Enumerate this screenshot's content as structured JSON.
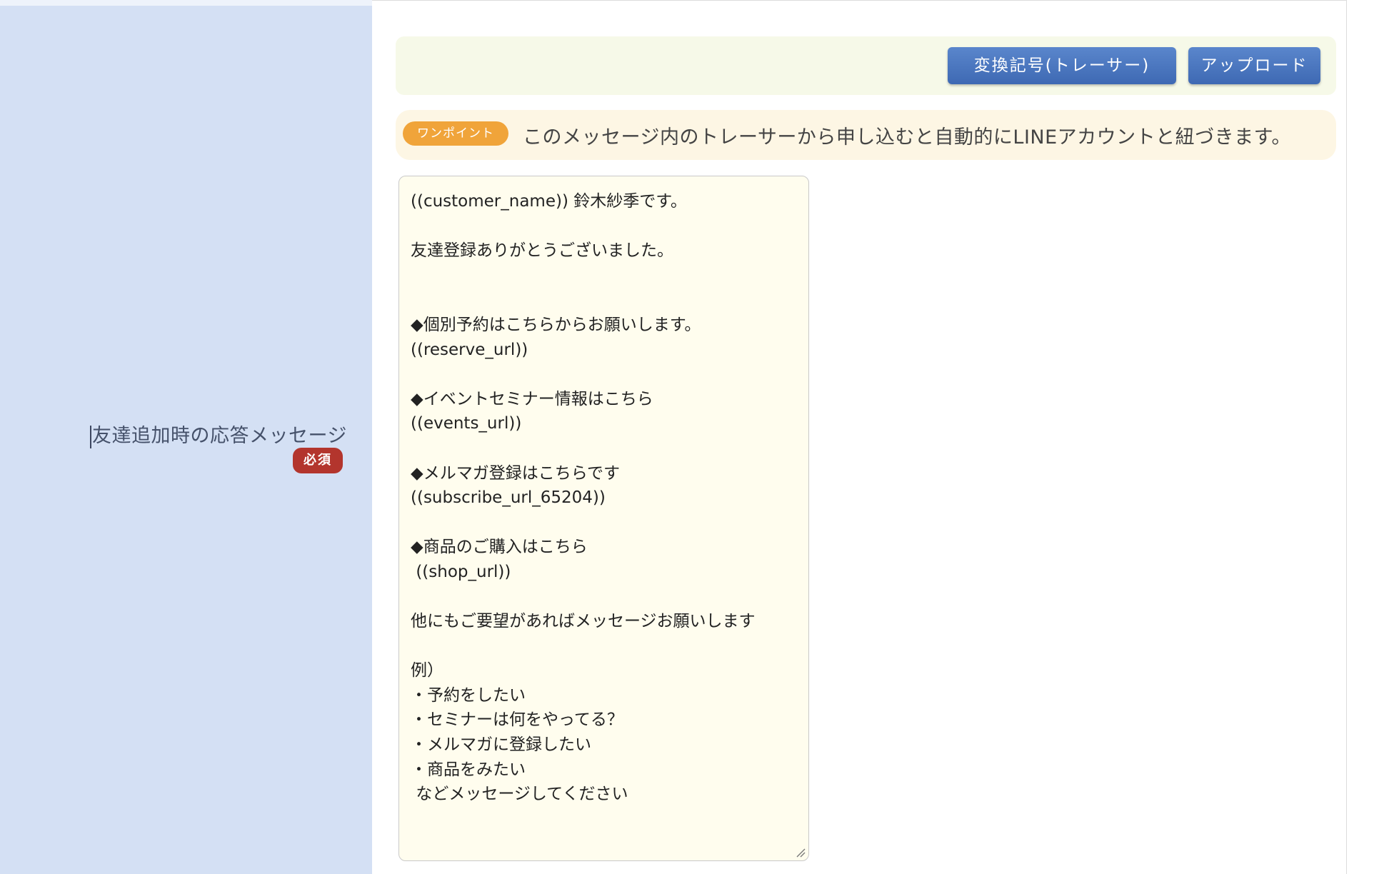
{
  "field": {
    "label": "友達追加時の応答メッセージ",
    "required_badge": "必須"
  },
  "toolbar": {
    "tracer_button": "変換記号(トレーサー)",
    "upload_button": "アップロード"
  },
  "tip": {
    "badge": "ワンポイント",
    "text": "このメッセージ内のトレーサーから申し込むと自動的にLINEアカウントと紐づきます。"
  },
  "message": {
    "value": "((customer_name)) 鈴木紗季です。\n\n友達登録ありがとうございました。\n\n\n◆個別予約はこちらからお願いします。\n((reserve_url))\n\n◆イベントセミナー情報はこちら\n((events_url))\n\n◆メルマガ登録はこちらです\n((subscribe_url_65204))\n\n◆商品のご購入はこちら\n ((shop_url))\n\n他にもご要望があればメッセージお願いします\n\n例）\n・予約をしたい\n・セミナーは何をやってる？\n・メルマガに登録したい\n・商品をみたい\n などメッセージしてください"
  },
  "colors": {
    "label_column_bg": "#d4e0f4",
    "required_badge": "#b3352d",
    "button_blue": "#3e69b3",
    "tip_badge": "#f0a43a",
    "tip_bg": "#fdf6e4",
    "toolbar_bg": "#f6f9e8",
    "textarea_bg": "#fffdee"
  },
  "icons": {
    "resize_handle": "resize-grip-icon"
  }
}
